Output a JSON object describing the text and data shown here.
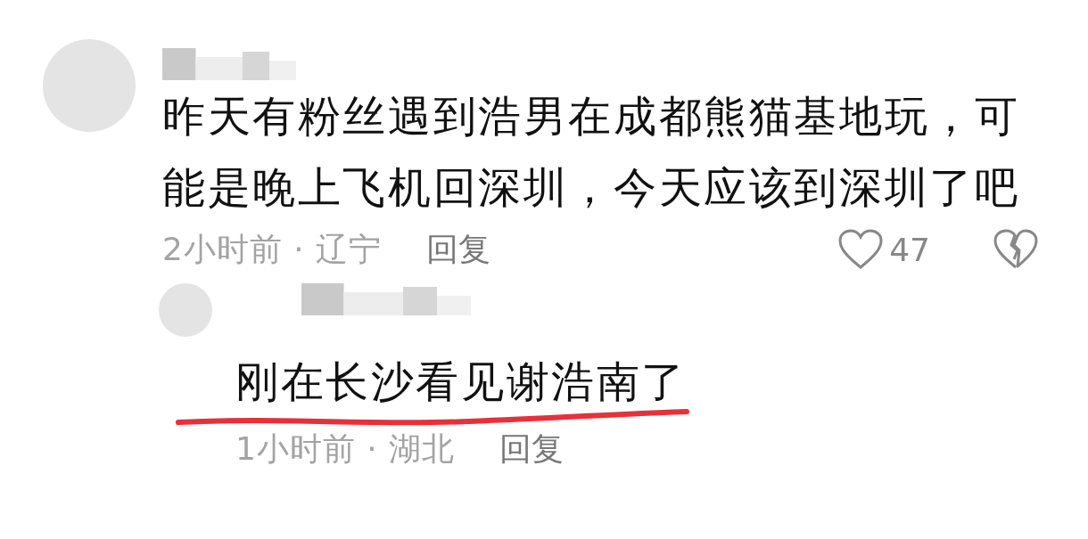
{
  "comments": [
    {
      "text": "昨天有粉丝遇到浩男在成都熊猫基地玩，可能是晚上飞机回深圳，今天应该到深圳了吧",
      "meta": "2小时前 · 辽宁",
      "reply_label": "回复",
      "like_count": "47",
      "liked": false,
      "replies": [
        {
          "text": "刚在长沙看见谢浩南了",
          "meta": "1小时前 · 湖北",
          "reply_label": "回复",
          "underlined": true
        }
      ]
    }
  ]
}
